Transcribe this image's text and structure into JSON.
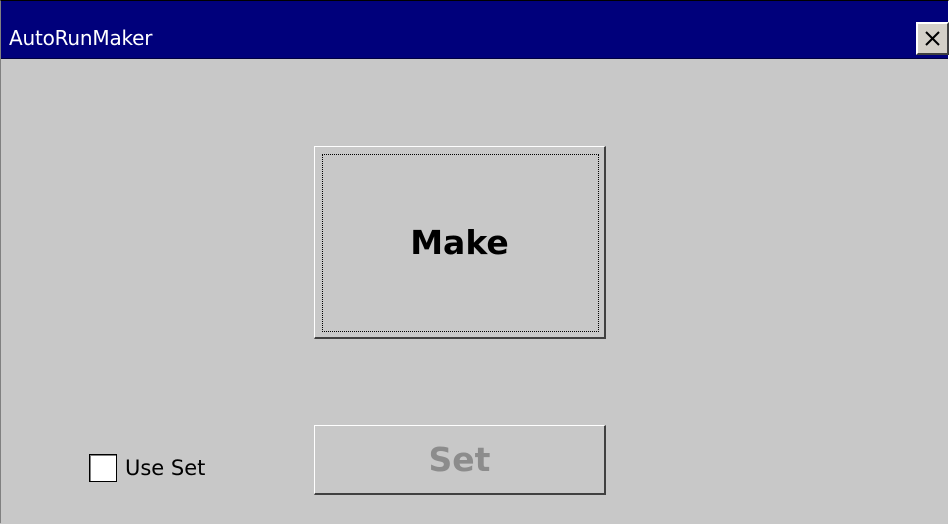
{
  "window": {
    "title": "AutoRunMaker",
    "close_icon": "close-icon"
  },
  "main": {
    "make_label": "Make",
    "set_label": "Set",
    "set_enabled": false,
    "use_set": {
      "label": "Use Set",
      "checked": false
    }
  },
  "colors": {
    "titlebar": "#00007b",
    "face": "#c8c8c8",
    "disabled_text": "#8c8c8c"
  }
}
